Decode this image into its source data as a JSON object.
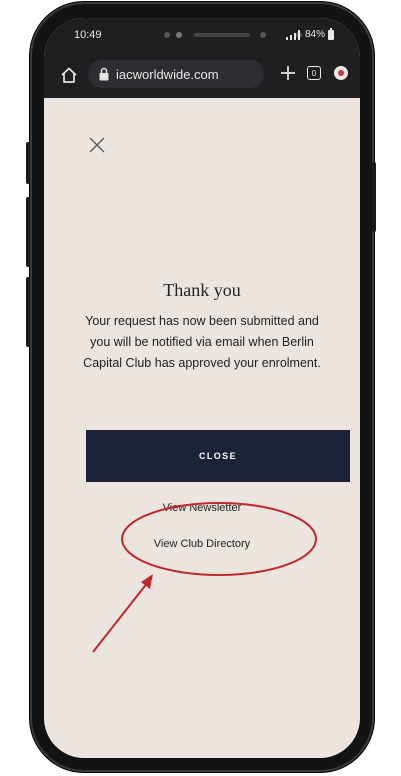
{
  "status_bar": {
    "time": "10:49",
    "battery": "84%"
  },
  "browser": {
    "url": "iacworldwide.com",
    "icons": [
      "home-icon",
      "lock-icon",
      "plus-icon",
      "tabs-icon",
      "menu-icon"
    ]
  },
  "dialog": {
    "title": "Thank you",
    "message": "Your request has now been submitted and you will be notified via email when Berlin Capital Club has approved your enrolment.",
    "close_button": "CLOSE",
    "links": [
      "View Newsletter",
      "View Club Directory"
    ]
  },
  "colors": {
    "page_bg": "#ece5df",
    "button_bg": "#1c2237",
    "annotation": "#c0282b"
  }
}
